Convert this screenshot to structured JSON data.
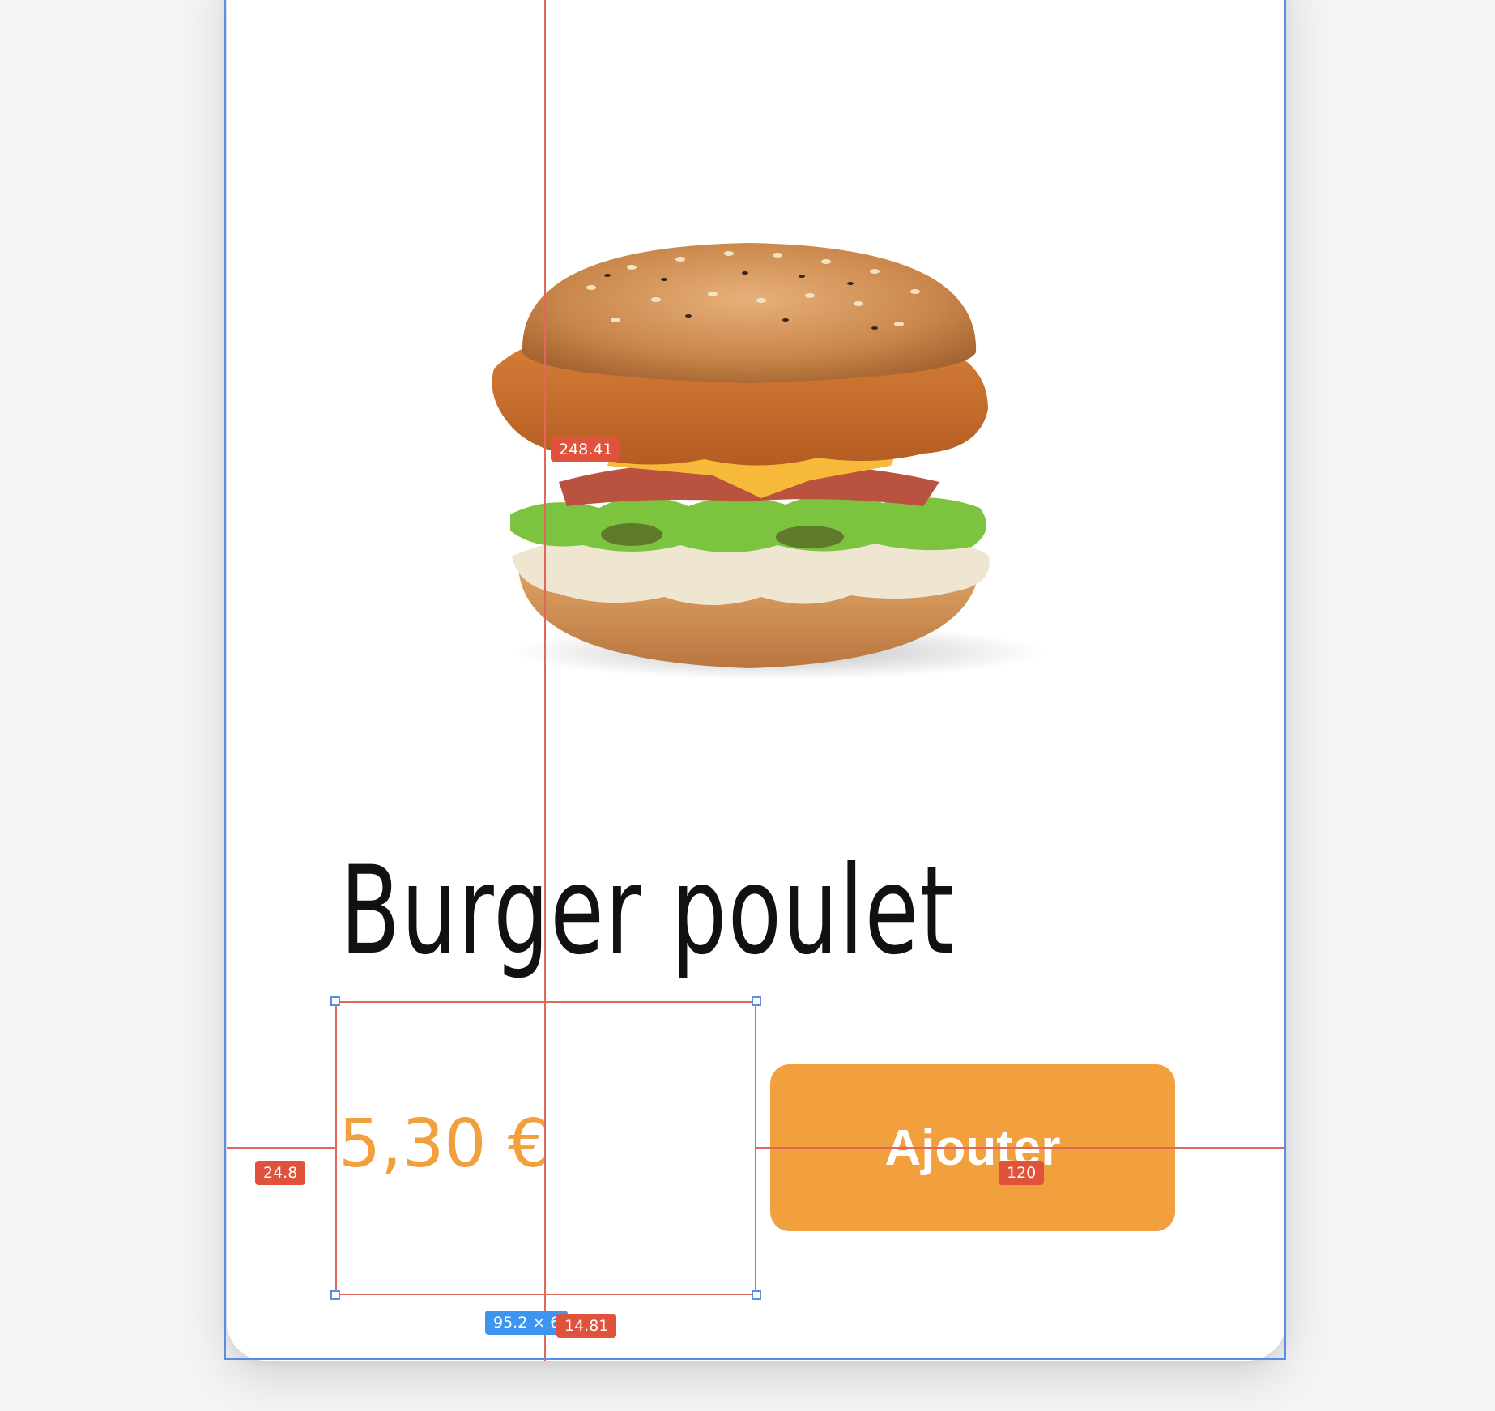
{
  "product": {
    "name": "Burger poulet",
    "price": "5,30 €",
    "add_label": "Ajouter",
    "image_icon": "burger-image"
  },
  "overlay": {
    "badge_spacing_top": "248.41",
    "badge_spacing_left": "24.8",
    "badge_spacing_right": "120",
    "badge_spacing_bottom": "14.81",
    "badge_dimensions": "95.2 × 6"
  },
  "colors": {
    "accent": "#f2a03d",
    "guide": "#e0675a",
    "selection": "#5a8ee6",
    "text": "#111111"
  }
}
